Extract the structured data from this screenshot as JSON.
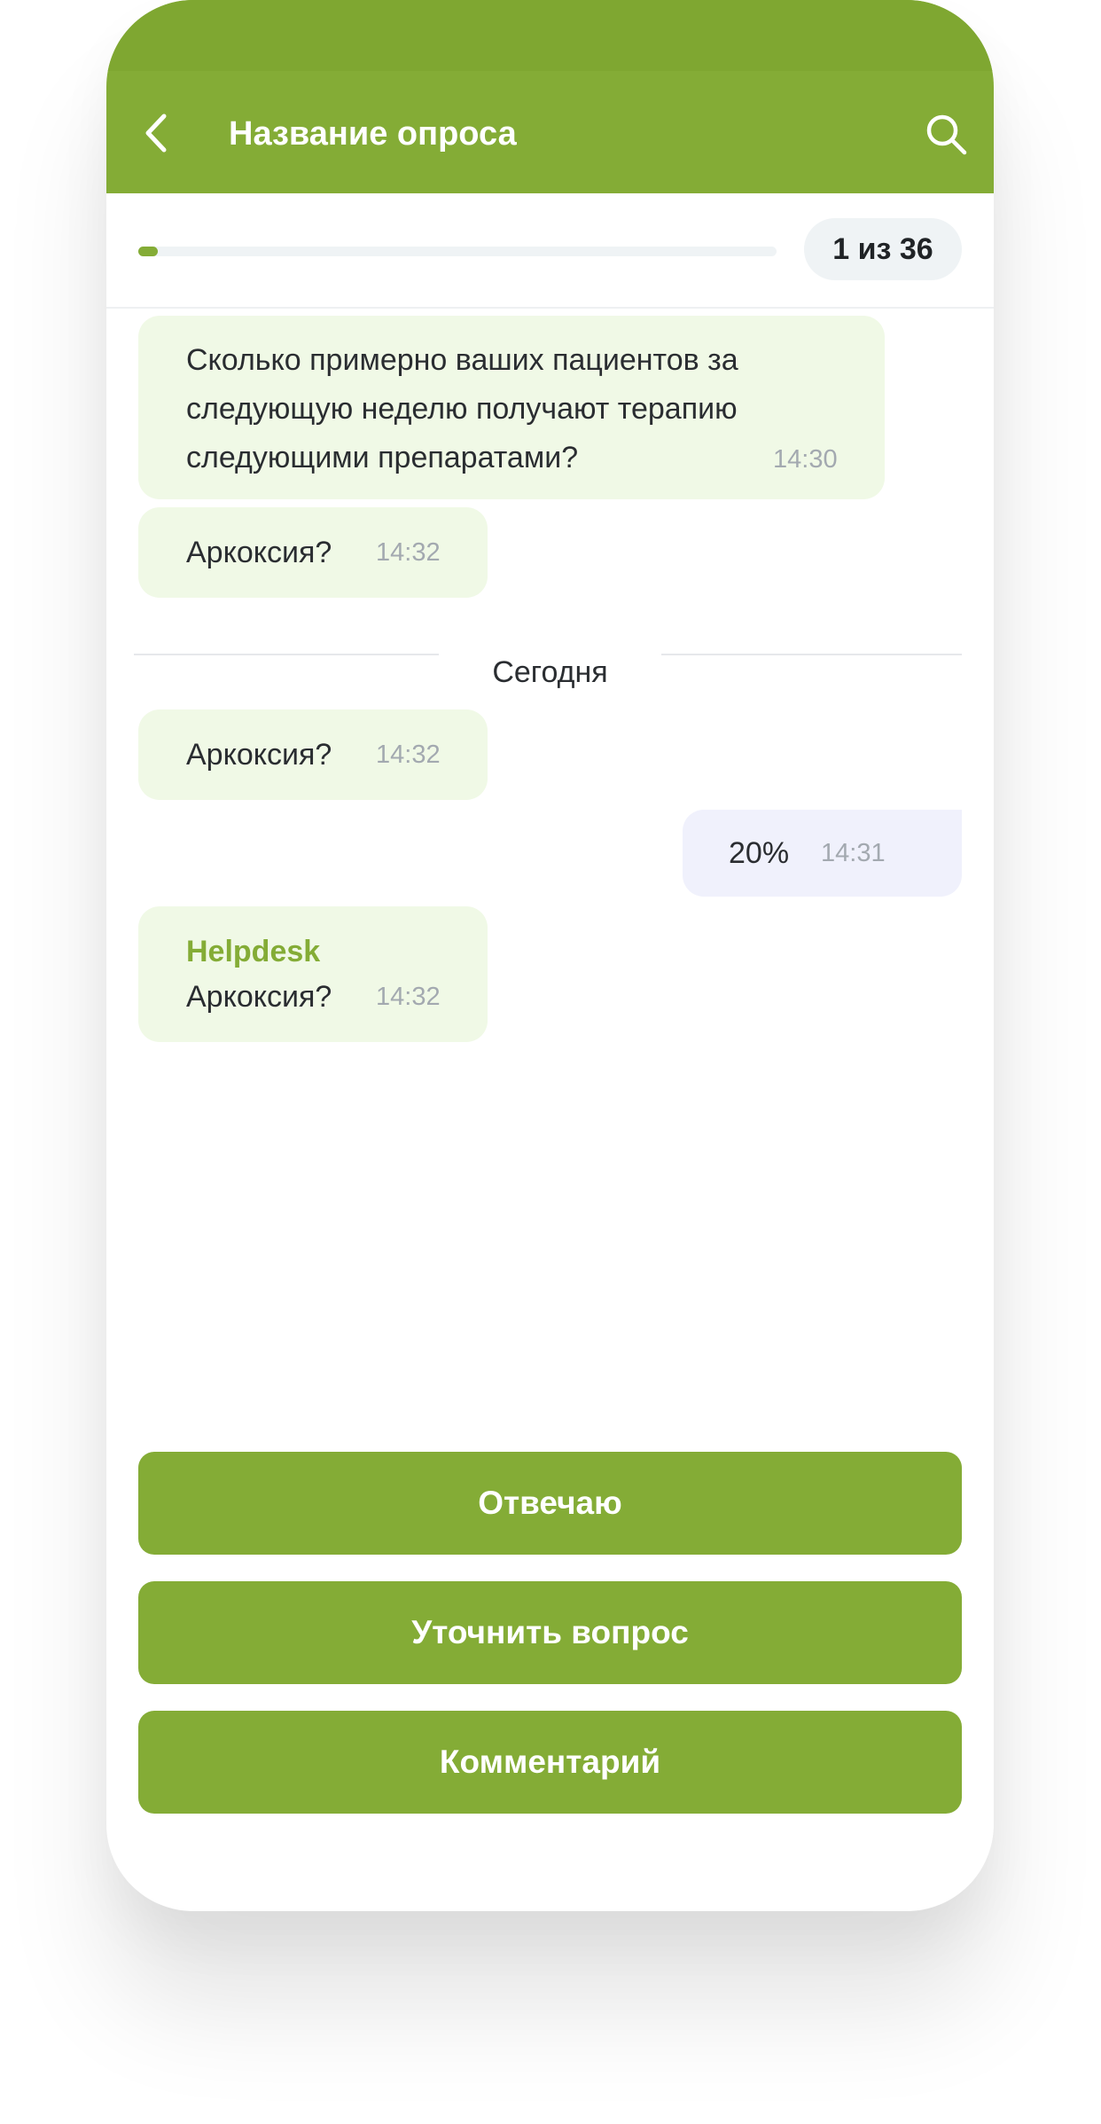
{
  "header": {
    "title": "Название опроса",
    "back_icon": "chevron-left-icon",
    "search_icon": "search-icon",
    "accent_color": "#84ac36"
  },
  "progress": {
    "fraction": 0.028,
    "counter_label": "1 из 36"
  },
  "messages": [
    {
      "sender": "",
      "direction": "in",
      "lines": [
        "Сколько примерно ваших пациентов за",
        "следующую неделю получают терапию",
        "следующими препаратами?"
      ],
      "time": "14:30"
    },
    {
      "sender": "",
      "direction": "in",
      "text": "Аркоксия?",
      "time": "14:32"
    }
  ],
  "divider": {
    "label": "Сегодня"
  },
  "today_messages": [
    {
      "sender": "",
      "direction": "in",
      "text": "Аркоксия?",
      "time": "14:32"
    },
    {
      "sender": "",
      "direction": "out",
      "text": "20%",
      "time": "14:31"
    },
    {
      "sender": "Helpdesk",
      "direction": "in",
      "text": "Аркоксия?",
      "time": "14:32"
    }
  ],
  "actions": {
    "answer_label": "Отвечаю",
    "clarify_label": "Уточнить вопрос",
    "comment_label": "Комментарий"
  }
}
